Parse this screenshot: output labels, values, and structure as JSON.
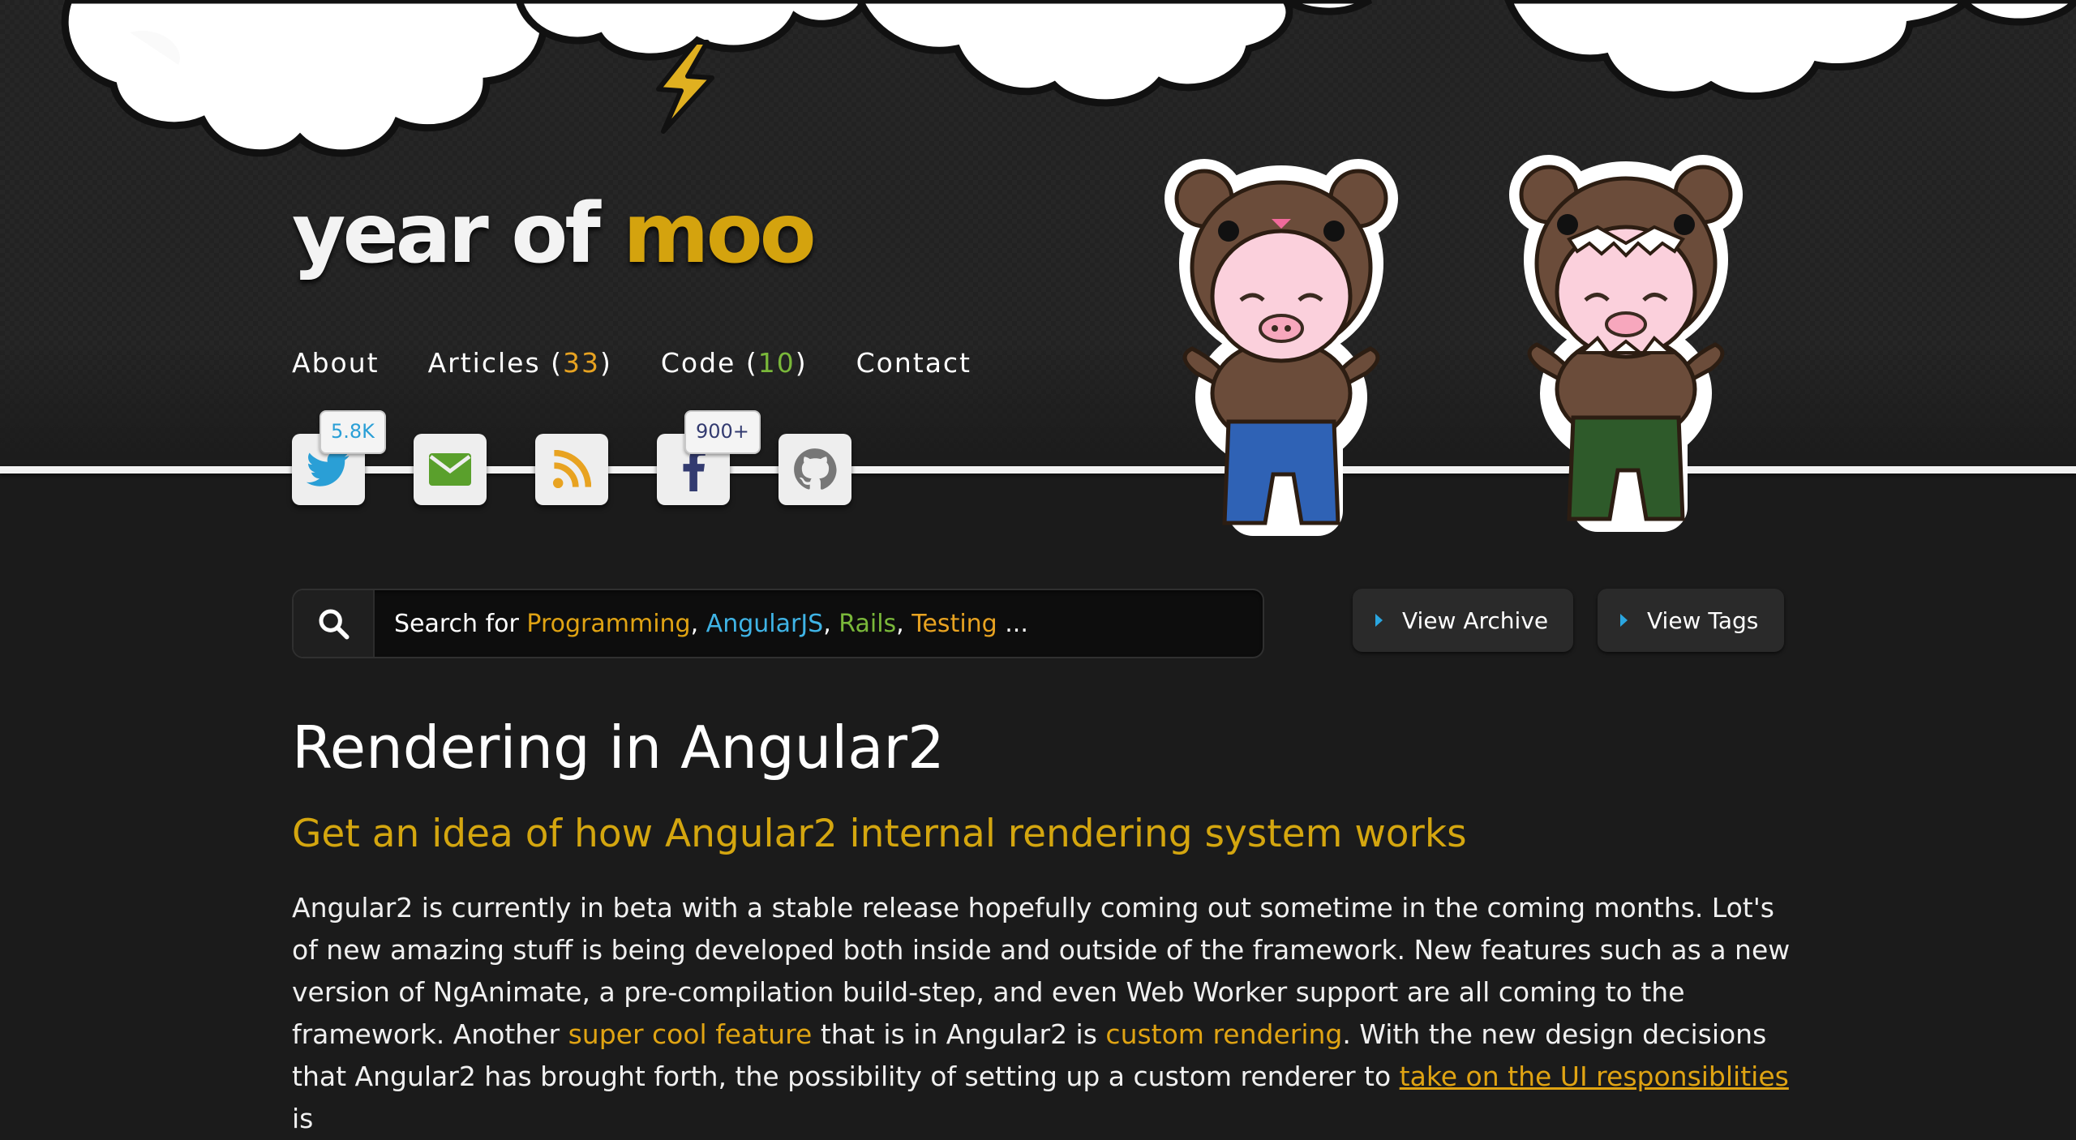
{
  "header": {
    "logo": {
      "part1": "year of ",
      "part2": "moo"
    },
    "nav": [
      {
        "label": "About"
      },
      {
        "label": "Articles (",
        "count": "33",
        "close": ")"
      },
      {
        "label": "Code (",
        "count": "10",
        "close": ")"
      },
      {
        "label": "Contact"
      }
    ],
    "social": {
      "twitter_count": "5.8K",
      "facebook_count": "900+"
    }
  },
  "search": {
    "prefix": "Search for ",
    "terms": [
      "Programming",
      "AngularJS",
      "Rails",
      "Testing"
    ],
    "sep": ", ",
    "suffix": " ..."
  },
  "buttons": {
    "archive": "View Archive",
    "tags": "View Tags"
  },
  "article": {
    "title": "Rendering in Angular2",
    "subtitle": "Get an idea of how Angular2 internal rendering system works",
    "p1": "Angular2 is currently in beta with a stable release hopefully coming out sometime in the coming months. Lot's of new amazing stuff is being developed both inside and outside of the framework. New features such as a new version of NgAnimate, a pre-compilation build-step, and even Web Worker support are all coming to the framework. Another ",
    "link1": "super cool feature",
    "p2": " that is in Angular2 is ",
    "link2": "custom rendering",
    "p3": ". With the new design decisions that Angular2 has brought forth, the possibility of setting up a custom renderer to ",
    "link3": "take on the UI responsiblities",
    "p4": " is"
  },
  "colors": {
    "accent_gold": "#d4a60f",
    "accent_orange": "#e8a321",
    "accent_green": "#7ab83a",
    "accent_blue": "#3fb4e6",
    "background": "#1b1b1b"
  }
}
